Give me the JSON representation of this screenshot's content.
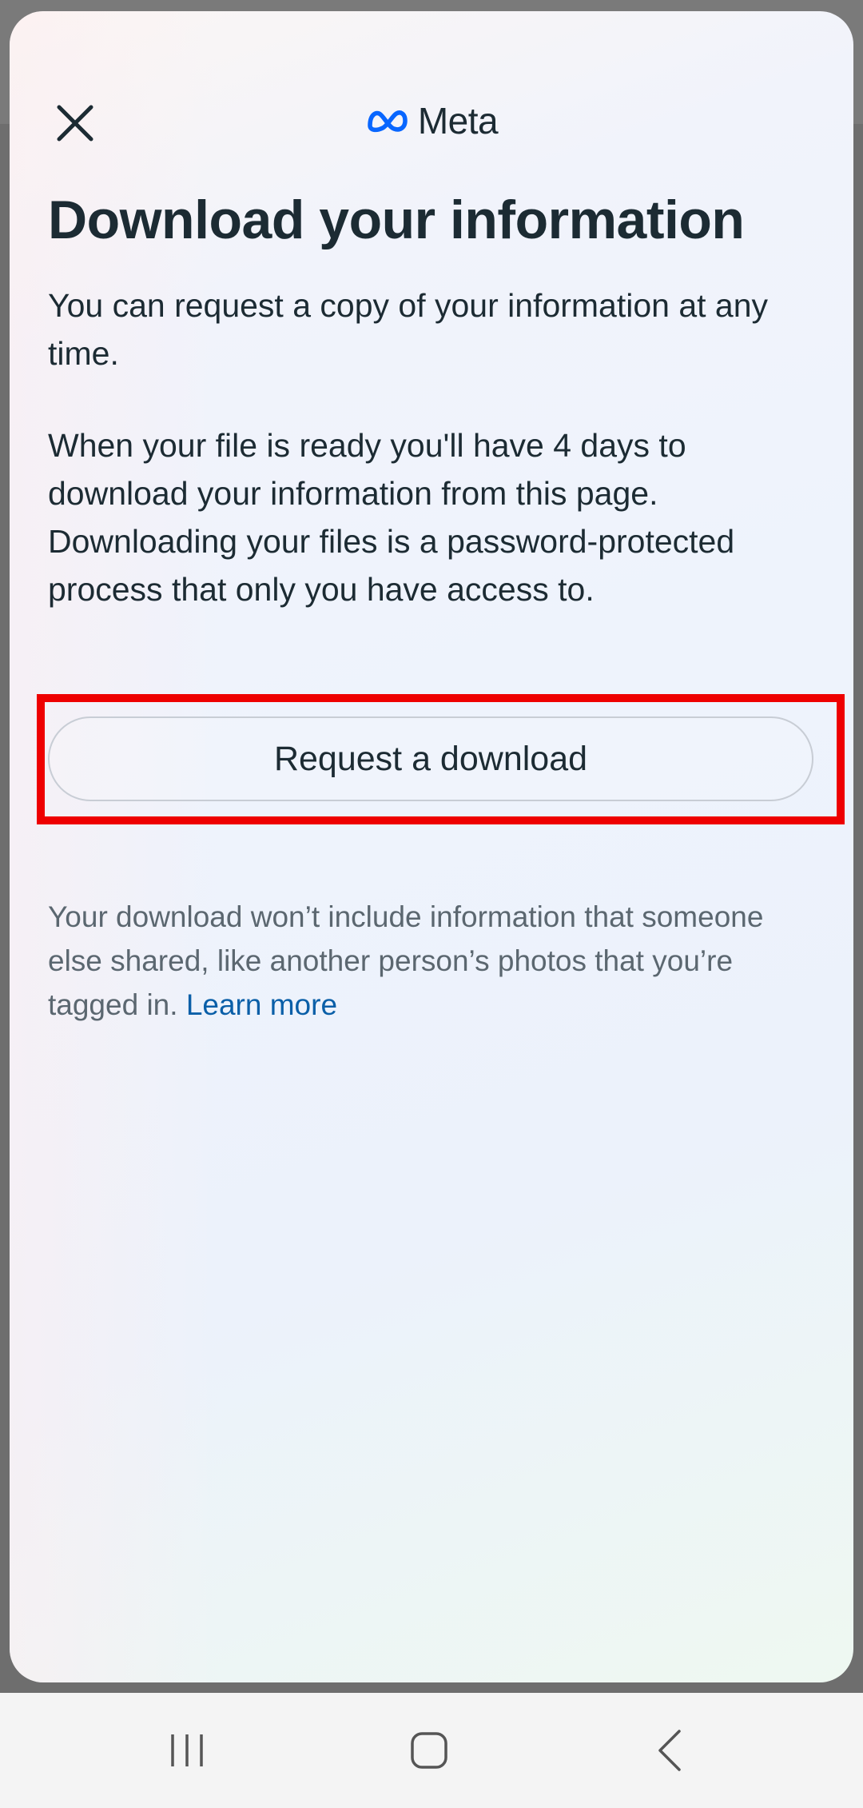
{
  "header": {
    "brand_name": "Meta",
    "close_icon": "close-icon",
    "brand_icon": "meta-infinity-logo",
    "brand_color": "#0866ff"
  },
  "main": {
    "title": "Download your information",
    "paragraph_1": "You can request a copy of your information at any time.",
    "paragraph_2": "When your file is ready you'll have 4 days to download your information from this page. Downloading your files is a password-protected process that only you have access to.",
    "request_button_label": "Request a download",
    "disclaimer": "Your download won’t include information that someone else shared, like another person’s photos that you’re tagged in.",
    "learn_more_label": "Learn more",
    "link_color": "#0a5fa8",
    "highlight_color": "#ee0000"
  },
  "system_nav": {
    "recents_icon": "recents-icon",
    "home_icon": "home-icon",
    "back_icon": "back-icon"
  }
}
